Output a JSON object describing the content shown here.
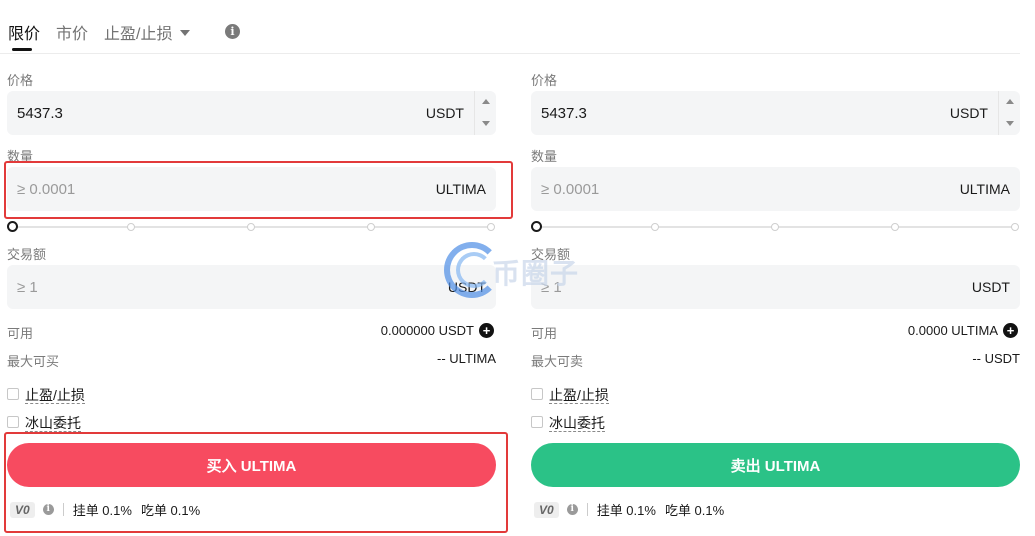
{
  "tabs": {
    "limit": "限价",
    "market": "市价",
    "tpsl": "止盈/止损"
  },
  "buy_panel": {
    "price_label": "价格",
    "price_value": "5437.3",
    "price_unit": "USDT",
    "amount_label": "数量",
    "amount_placeholder": "≥ 0.0001",
    "amount_unit": "ULTIMA",
    "total_label": "交易额",
    "total_placeholder": "≥ 1",
    "total_unit": "USDT",
    "available_label": "可用",
    "available_value": "0.000000 USDT",
    "max_label": "最大可买",
    "max_value": "-- ULTIMA",
    "tpsl_label": "止盈/止损",
    "iceberg_label": "冰山委托",
    "action_label": "买入 ULTIMA",
    "vip_level": "V0",
    "maker_fee": "挂单 0.1%",
    "taker_fee": "吃单 0.1%"
  },
  "sell_panel": {
    "price_label": "价格",
    "price_value": "5437.3",
    "price_unit": "USDT",
    "amount_label": "数量",
    "amount_placeholder": "≥ 0.0001",
    "amount_unit": "ULTIMA",
    "total_label": "交易额",
    "total_placeholder": "≥ 1",
    "total_unit": "USDT",
    "available_label": "可用",
    "available_value": "0.0000 ULTIMA",
    "max_label": "最大可卖",
    "max_value": "-- USDT",
    "tpsl_label": "止盈/止损",
    "iceberg_label": "冰山委托",
    "action_label": "卖出 ULTIMA",
    "vip_level": "V0",
    "maker_fee": "挂单 0.1%",
    "taker_fee": "吃单 0.1%"
  },
  "watermark": {
    "text": "币圈子"
  },
  "colors": {
    "buy": "#f74b60",
    "sell": "#2bc287",
    "highlight": "#e23a3a",
    "field_bg": "#f4f5f6"
  }
}
